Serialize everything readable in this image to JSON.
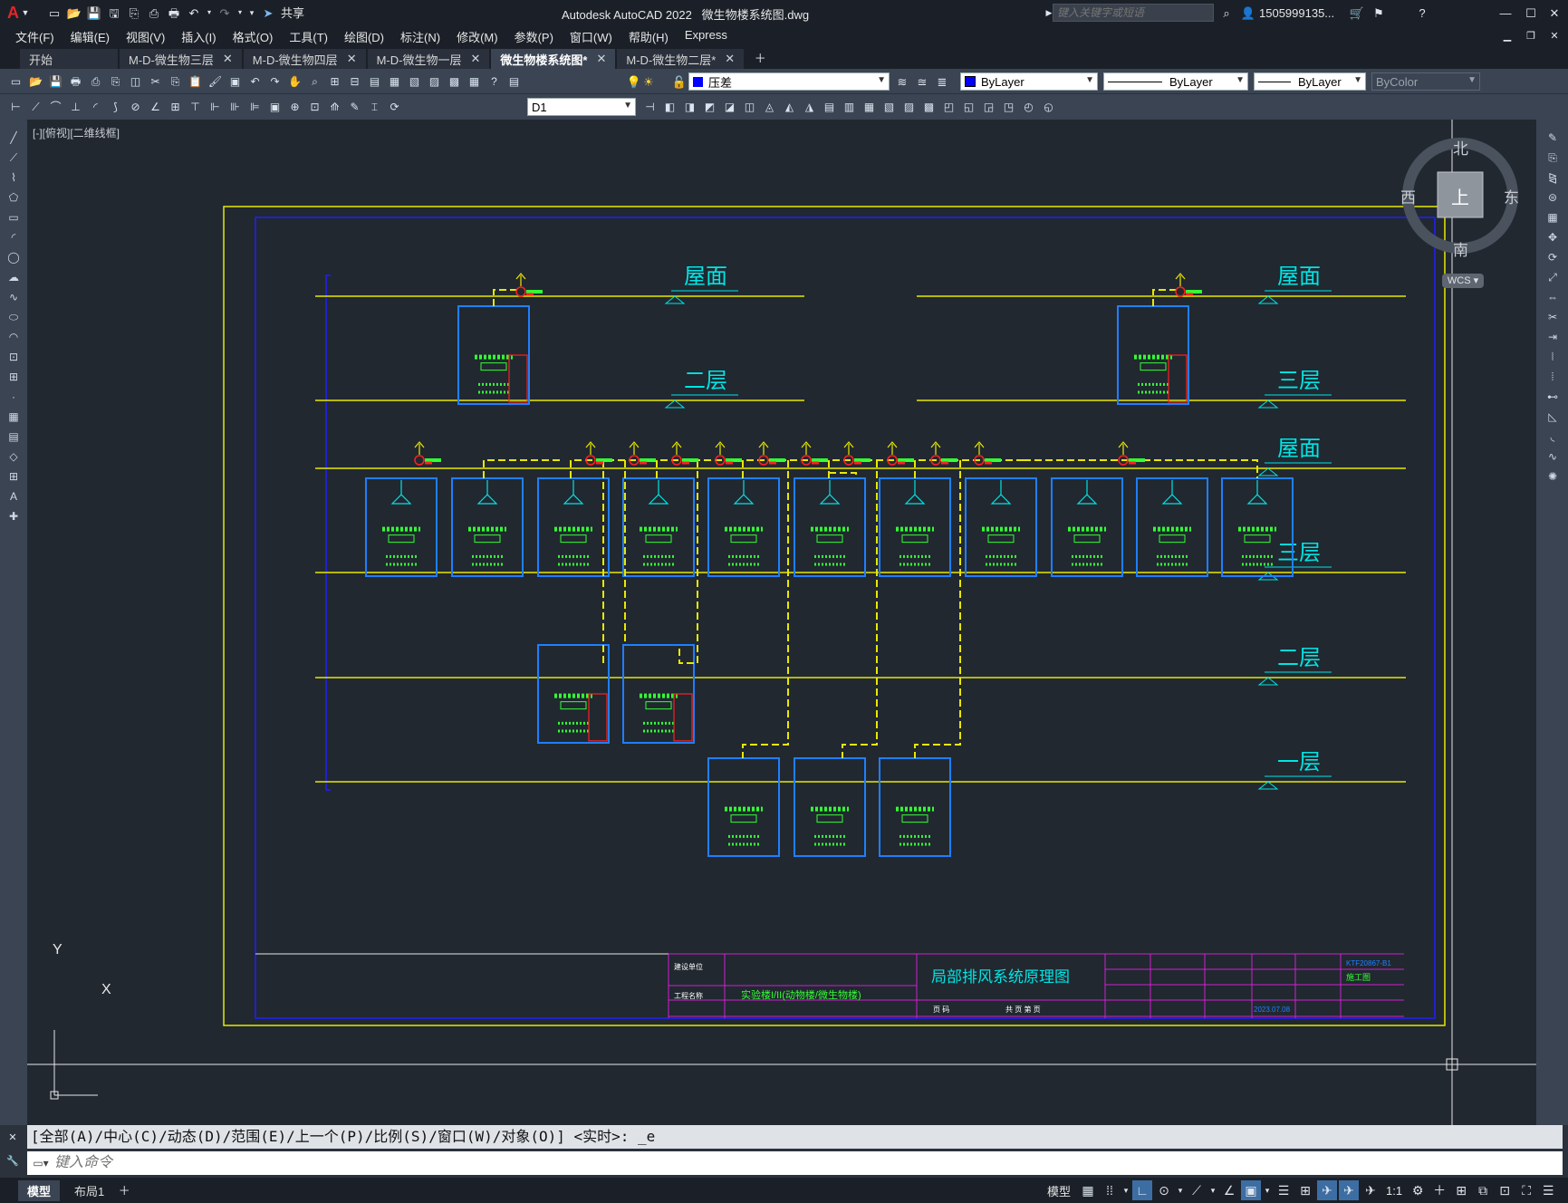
{
  "app": {
    "title": "Autodesk AutoCAD 2022",
    "filename": "微生物楼系统图.dwg",
    "search_placeholder": "键入关键字或短语",
    "user": "1505999135...",
    "share": "共享",
    "app_letter": "A"
  },
  "menu": [
    "文件(F)",
    "编辑(E)",
    "视图(V)",
    "插入(I)",
    "格式(O)",
    "工具(T)",
    "绘图(D)",
    "标注(N)",
    "修改(M)",
    "参数(P)",
    "窗口(W)",
    "帮助(H)",
    "Express"
  ],
  "tabs": [
    {
      "label": "开始",
      "closable": false,
      "active": false
    },
    {
      "label": "M-D-微生物三层",
      "closable": true,
      "active": false
    },
    {
      "label": "M-D-微生物四层",
      "closable": true,
      "active": false
    },
    {
      "label": "M-D-微生物一层",
      "closable": true,
      "active": false
    },
    {
      "label": "微生物楼系统图*",
      "closable": true,
      "active": true
    },
    {
      "label": "M-D-微生物二层*",
      "closable": true,
      "active": false
    }
  ],
  "toolbar": {
    "layer": "压差",
    "color": "ByLayer",
    "linetype": "ByLayer",
    "lineweight": "ByLayer",
    "plotstyle": "ByColor",
    "dimstyle": "D1"
  },
  "viewport": {
    "label": "[-][俯视][二维线框]",
    "compass": {
      "north": "北",
      "south": "南",
      "east": "东",
      "west": "西",
      "center": "上"
    },
    "wcs": "WCS",
    "ucs_x": "X",
    "ucs_y": "Y"
  },
  "drawing": {
    "floors": {
      "roof": "屋面",
      "f3": "三层",
      "f2": "二层",
      "f1": "一层"
    },
    "title_block": {
      "drawing_title": "局部排风系统原理图",
      "project": "实验楼I/II(动物楼/微生物楼)",
      "construction_unit_label": "建设单位",
      "project_name_label": "工程名称",
      "sheet_row": "页 码",
      "sheet_total": "共 页 第 页",
      "stage": "施工图",
      "code": "KTF20867-B1",
      "date": "2023.07.08"
    }
  },
  "command": {
    "history": "[全部(A)/中心(C)/动态(D)/范围(E)/上一个(P)/比例(S)/窗口(W)/对象(O)] <实时>: _e",
    "placeholder": "键入命令"
  },
  "status": {
    "model": "模型",
    "layout": "布局1",
    "model_btn": "模型",
    "scale": "1:1"
  }
}
